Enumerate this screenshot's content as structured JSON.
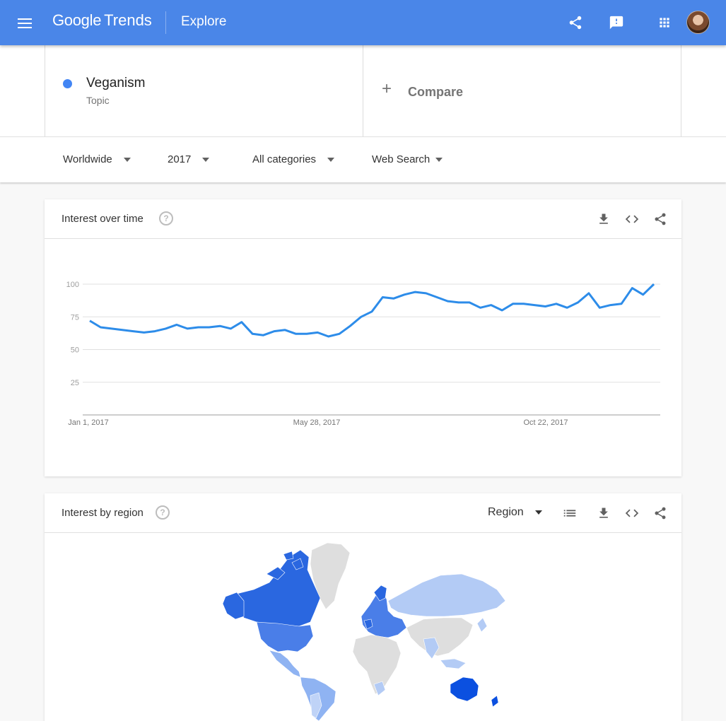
{
  "header": {
    "menu_icon": "menu-icon",
    "logo_google": "Google",
    "logo_trends": "Trends",
    "page": "Explore",
    "icons": [
      "share-icon",
      "feedback-icon",
      "apps-icon",
      "avatar"
    ]
  },
  "term": {
    "name": "Veganism",
    "type": "Topic",
    "color": "#4285f4"
  },
  "compare": {
    "label": "Compare"
  },
  "filters": {
    "region": "Worldwide",
    "time": "2017",
    "category": "All categories",
    "property": "Web Search"
  },
  "interest_over_time": {
    "title": "Interest over time",
    "help": "?"
  },
  "chart_data": {
    "type": "line",
    "title": "Interest over time",
    "x_tick_labels": [
      "Jan 1, 2017",
      "May 28, 2017",
      "Oct 22, 2017"
    ],
    "y_ticks": [
      25,
      50,
      75,
      100
    ],
    "ylim": [
      0,
      100
    ],
    "grid": true,
    "series": [
      {
        "color": "#4285f4",
        "values": [
          72,
          67,
          66,
          65,
          64,
          63,
          64,
          66,
          69,
          66,
          67,
          67,
          68,
          66,
          71,
          62,
          61,
          64,
          65,
          62,
          62,
          63,
          60,
          62,
          68,
          75,
          79,
          90,
          89,
          92,
          94,
          93,
          90,
          87,
          86,
          86,
          82,
          84,
          80,
          85,
          85,
          84,
          83,
          85,
          82,
          86,
          93,
          82,
          84,
          85,
          97,
          92,
          100
        ]
      }
    ]
  },
  "interest_by_region": {
    "title": "Interest by region",
    "help": "?",
    "resolution": "Region"
  }
}
